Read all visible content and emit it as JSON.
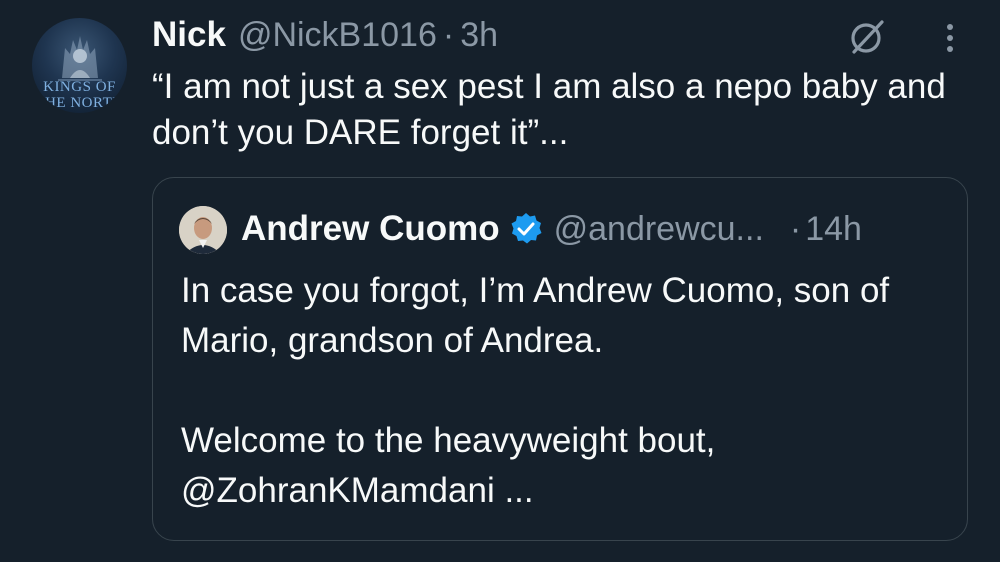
{
  "tweet": {
    "author_name": "Nick",
    "author_handle": "@NickB1016",
    "separator": "·",
    "time": "3h",
    "avatar_text_line1": "KINGS OF",
    "avatar_text_line2": "THE NORTH",
    "text": "“I am not just a sex pest I am also a nepo baby and don’t you DARE forget it”..."
  },
  "quoted_tweet": {
    "author_name": "Andrew Cuomo",
    "author_handle": "@andrewcu...",
    "separator": "·",
    "time": "14h",
    "text_paragraph_1": "In case you forgot, I’m Andrew Cuomo, son of Mario, grandson of Andrea.",
    "text_paragraph_2": "Welcome to the heavyweight bout, @ZohranKMamdani ..."
  },
  "icons": {
    "grok": "grok-icon",
    "more": "more-icon",
    "verified": "verified-badge-icon"
  },
  "colors": {
    "background": "#15202b",
    "primary_text": "#f7f9f9",
    "secondary_text": "#8b98a5",
    "border": "#38444d",
    "verified_blue": "#1d9bf0"
  }
}
